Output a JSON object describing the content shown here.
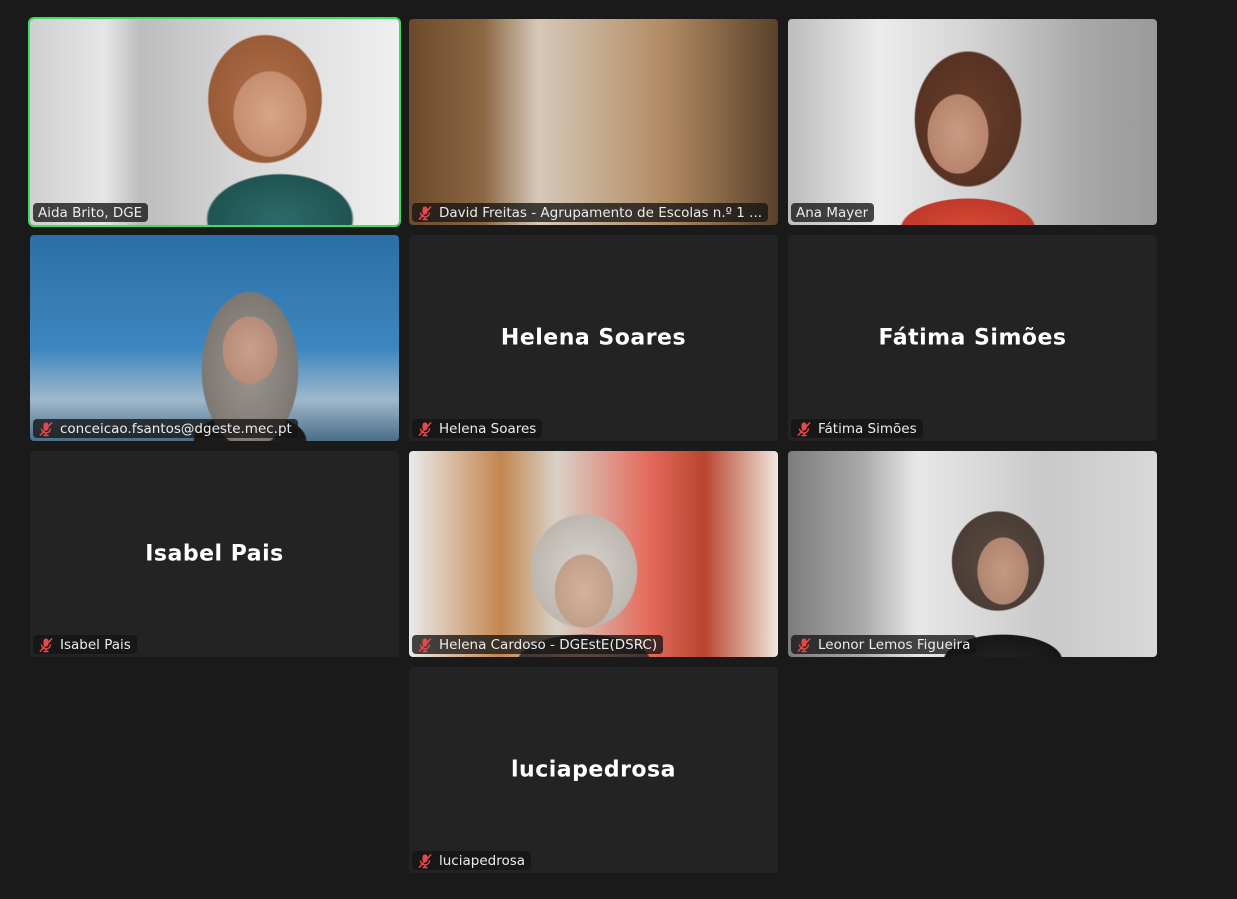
{
  "participants": [
    {
      "label": "Aida Brito, DGE",
      "muted": false,
      "video": true,
      "active": true
    },
    {
      "label": "David Freitas - Agrupamento de Escolas n.º 1 ...",
      "muted": true,
      "video": true
    },
    {
      "label": "Ana Mayer",
      "muted": false,
      "video": true
    },
    {
      "label": "conceicao.fsantos@dgeste.mec.pt",
      "muted": true,
      "video": true
    },
    {
      "label": "Helena Soares",
      "display_name": "Helena Soares",
      "muted": true,
      "video": false
    },
    {
      "label": "Fátima Simões",
      "display_name": "Fátima Simões",
      "muted": true,
      "video": false
    },
    {
      "label": "Isabel Pais",
      "display_name": "Isabel Pais",
      "muted": true,
      "video": false
    },
    {
      "label": "Helena Cardoso - DGEstE(DSRC)",
      "muted": true,
      "video": true
    },
    {
      "label": "Leonor Lemos Figueira",
      "muted": true,
      "video": true
    },
    {
      "label": "luciapedrosa",
      "display_name": "luciapedrosa",
      "muted": true,
      "video": false
    }
  ],
  "colors": {
    "background": "#1a1a1a",
    "tile": "#232323",
    "active_speaker_border": "#3ddc63",
    "muted_icon": "#e5484d"
  },
  "icons": {
    "muted": "mic-off-icon"
  }
}
